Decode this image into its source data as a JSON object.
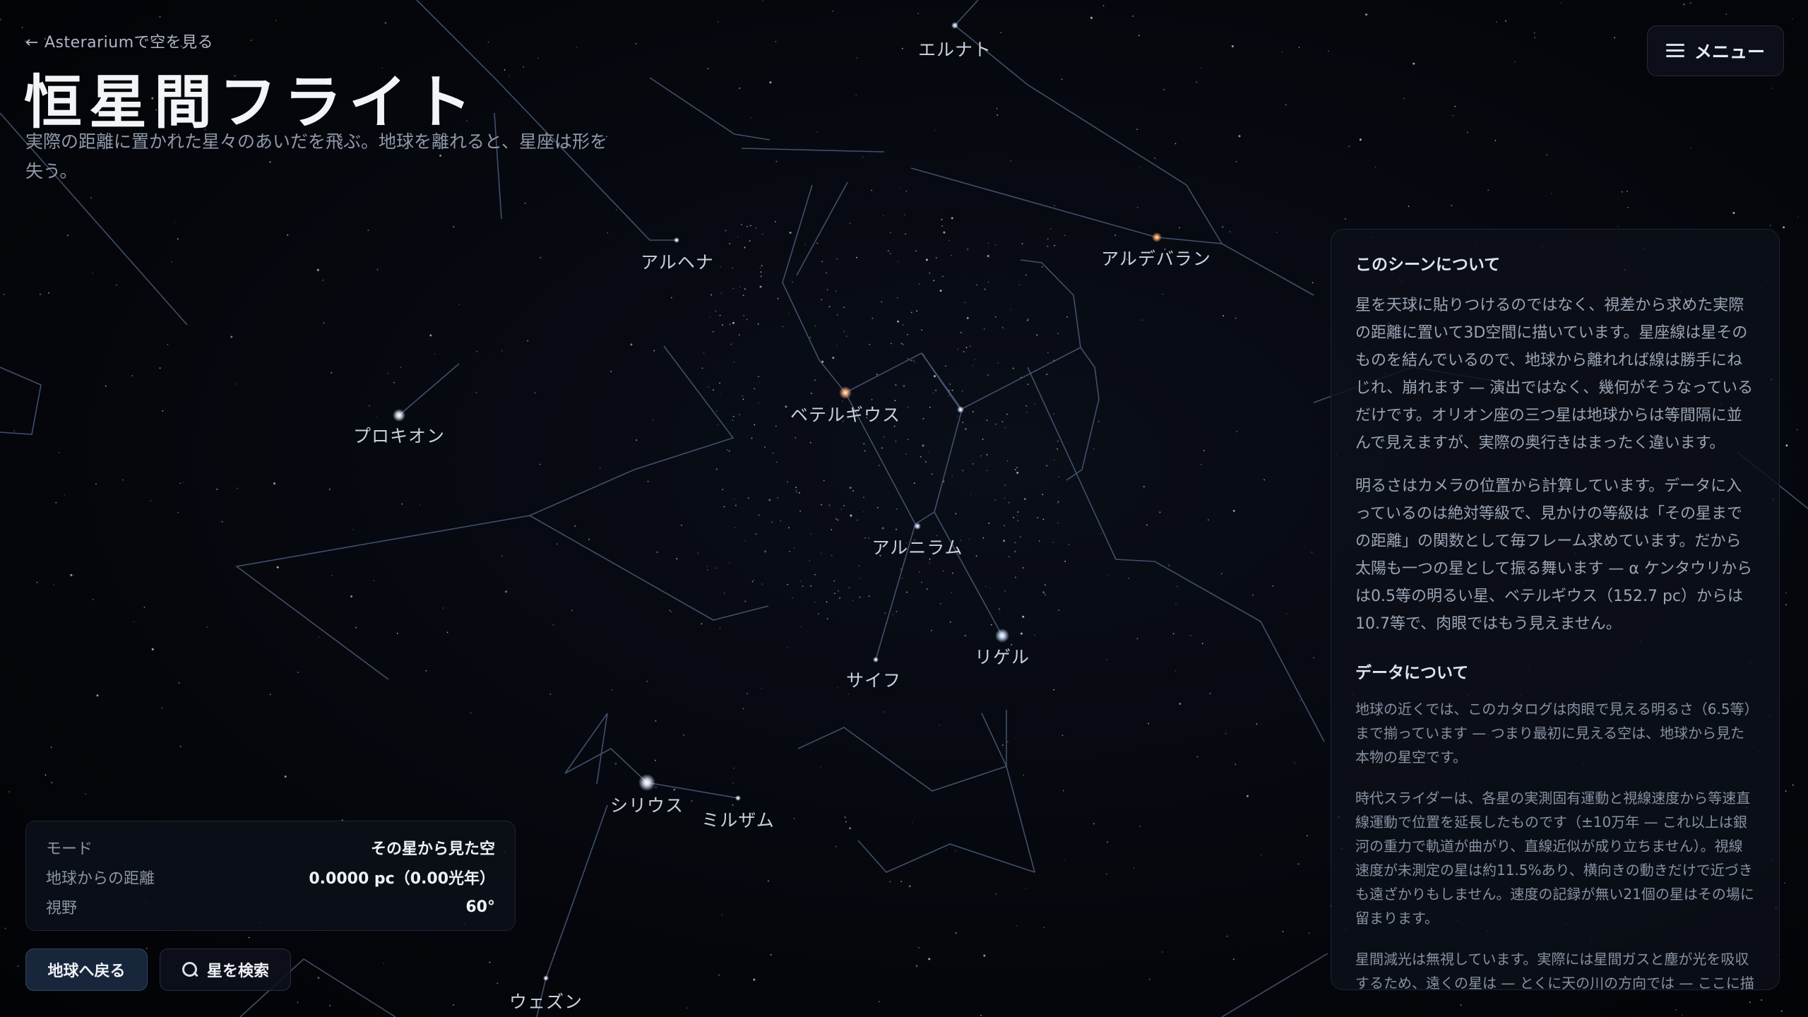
{
  "header": {
    "back_arrow": "←",
    "back_link": "Asterariumで空を見る",
    "title": "恒星間フライト",
    "subtitle": "実際の距離に置かれた星々のあいだを飛ぶ。地球を離れると、星座は形を失う。"
  },
  "menu": {
    "label": "メニュー",
    "icon": "hamburger-icon"
  },
  "star_labels": [
    {
      "name": "エルナト"
    },
    {
      "name": "アルヘナ"
    },
    {
      "name": "アルデバラン"
    },
    {
      "name": "プロキオン"
    },
    {
      "name": "ベテルギウス"
    },
    {
      "name": "アルニラム"
    },
    {
      "name": "リゲル"
    },
    {
      "name": "サイフ"
    },
    {
      "name": "シリウス"
    },
    {
      "name": "ミルザム"
    },
    {
      "name": "ウェズン"
    }
  ],
  "info_panel": {
    "section1_title": "このシーンについて",
    "section1_p1": "星を天球に貼りつけるのではなく、視差から求めた実際の距離に置いて3D空間に描いています。星座線は星そのものを結んでいるので、地球から離れれば線は勝手にねじれ、崩れます — 演出ではなく、幾何がそうなっているだけです。オリオン座の三つ星は地球からは等間隔に並んで見えますが、実際の奥行きはまったく違います。",
    "section1_p2": "明るさはカメラの位置から計算しています。データに入っているのは絶対等級で、見かけの等級は「その星までの距離」の関数として毎フレーム求めています。だから太陽も一つの星として振る舞います — α ケンタウリからは0.5等の明るい星、ベテルギウス（152.7 pc）からは10.7等で、肉眼ではもう見えません。",
    "section2_title": "データについて",
    "section2_p1": "地球の近くでは、このカタログは肉眼で見える明るさ（6.5等）まで揃っています — つまり最初に見える空は、地球から見た本物の星空です。",
    "section2_p2": "時代スライダーは、各星の実測固有運動と視線速度から等速直線運動で位置を延長したものです（±10万年 — これ以上は銀河の重力で軌道が曲がり、直線近似が成り立ちません）。視線速度が未測定の星は約11.5%あり、横向きの動きだけで近づきも遠ざかりもしません。速度の記録が無い21個の星はその場に留まります。",
    "section2_p3": "星間減光は無視しています。実際には星間ガスと塵が光を吸収するため、遠くの星は — とくに天の川の方向では — ここに描"
  },
  "status": {
    "mode_label": "モード",
    "mode_value": "その星から見た空",
    "distance_label": "地球からの距離",
    "distance_value": "0.0000 pc（0.00光年）",
    "fov_label": "視野",
    "fov_value": "60°"
  },
  "buttons": {
    "earth": "地球へ戻る",
    "search": "星を検索",
    "search_icon": "search-icon"
  },
  "colors": {
    "background": "#03050a",
    "constellation_line": "#4a5d7a",
    "betelgeuse": "#ffb27a",
    "aldebaran": "#ffa860",
    "rigel": "#cfe0ff",
    "sirius": "#ffffff"
  }
}
